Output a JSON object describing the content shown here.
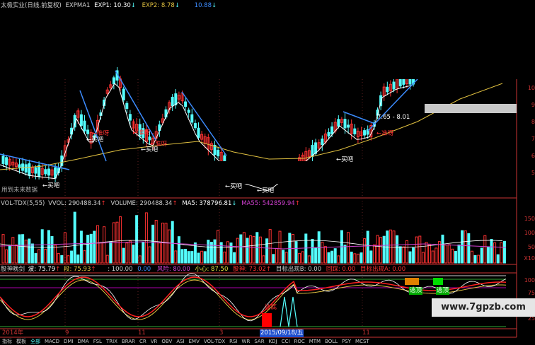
{
  "header": {
    "title": "太极实业(日线,前复权)",
    "indicator": "EXPMA1",
    "exp1": "EXP1: 10.30",
    "exp2": "EXP2: 8.78",
    "exp3": "10.88",
    "arrow_up": "↑",
    "arrow_down": "↓"
  },
  "main_chart": {
    "price_box": "7.65 - 8.01",
    "note": "用到未来数据",
    "buy_labels": [
      "←买吧",
      "←买吧",
      "←买吧",
      "←买吧",
      "←买吧",
      "←买吧"
    ],
    "sell_labels": [
      "←准呀",
      "←准呀",
      "←准呀",
      "←准呀"
    ],
    "axis": [
      "10",
      "9",
      "8",
      "7",
      "6",
      "5"
    ]
  },
  "volume_panel": {
    "title": "VOL-TDX(5,55)",
    "vvol": "VVOL: 290488.34",
    "volume": "VOLUME: 290488.34",
    "ma5": "MA5: 378796.81",
    "ma55": "MA55: 542859.94",
    "axis": [
      "150",
      "100",
      "50",
      "X10"
    ]
  },
  "signal_bar": {
    "name": "股神晚剑",
    "wave": "波: 75.79",
    "segment": "段: 75.93",
    "val100": ": 100.00",
    "val0": "0.00",
    "risk": "风险: 80.00",
    "care": "小心: 87.50",
    "god": "股神: 73.02",
    "target_b": "目标出现B: 0.00",
    "bounce": "回踩: 0.00",
    "target_a": "目标出现A: 0.00"
  },
  "osc_panel": {
    "bottom_label": "抄底",
    "escape1": "逃顶",
    "escape2": "逃顶",
    "axis": [
      "100",
      "75",
      "50",
      "25"
    ]
  },
  "date_axis": {
    "year": "2014年",
    "m1": "9",
    "m2": "11",
    "m3": "3",
    "selected_date": "2015/09/18/五",
    "m4": "11"
  },
  "tabs": [
    "指标",
    "模板",
    "全部",
    "MACD",
    "DMI",
    "DMA",
    "FSL",
    "TRIX",
    "BRAR",
    "CR",
    "VR",
    "OBV",
    "ASI",
    "EMV",
    "VOL-TDX",
    "RSI",
    "WR",
    "SAR",
    "KDJ",
    "CCI",
    "ROC",
    "MTM",
    "BOLL",
    "PSY",
    "MCST"
  ],
  "watermark": "www.7gpzb.com",
  "colors": {
    "up": "#ff3232",
    "down": "#54ffff",
    "exp1": "#ffffff",
    "exp2": "#e0c040",
    "trend": "#3c8cff",
    "ma55": "#d040d0"
  }
}
